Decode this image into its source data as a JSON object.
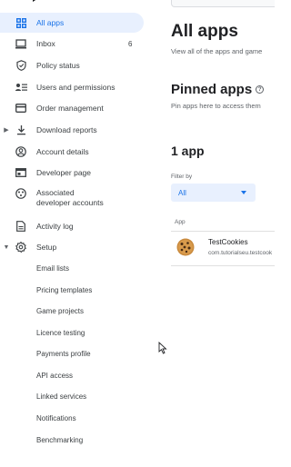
{
  "sidebar": {
    "items": [
      {
        "label": "All apps",
        "icon": "grid-icon",
        "active": true
      },
      {
        "label": "Inbox",
        "icon": "inbox-icon",
        "count": "6"
      },
      {
        "label": "Policy status",
        "icon": "shield-icon"
      },
      {
        "label": "Users and permissions",
        "icon": "users-icon"
      },
      {
        "label": "Order management",
        "icon": "credit-card-icon"
      },
      {
        "label": "Download reports",
        "icon": "download-icon"
      },
      {
        "label": "Account details",
        "icon": "account-circle-icon"
      },
      {
        "label": "Developer page",
        "icon": "web-page-icon"
      },
      {
        "label": "Associated developer accounts",
        "icon": "linked-accounts-icon"
      },
      {
        "label": "Activity log",
        "icon": "document-icon"
      },
      {
        "label": "Setup",
        "icon": "settings-icon"
      }
    ],
    "setup_items": [
      "Email lists",
      "Pricing templates",
      "Game projects",
      "Licence testing",
      "Payments profile",
      "API access",
      "Linked services",
      "Notifications",
      "Benchmarking"
    ]
  },
  "main": {
    "title": "All apps",
    "subtitle": "View all of the apps and game",
    "pinned_title": "Pinned apps",
    "pinned_desc": "Pin apps here to access them",
    "app_count": "1 app",
    "filter_label": "Filter by",
    "filter_value": "All",
    "column_app": "App",
    "apps": [
      {
        "name": "TestCookies",
        "package": "com.tutorialseu.testcook"
      }
    ]
  },
  "colors": {
    "accent": "#1a73e8",
    "active_bg": "#e8f0fe"
  }
}
